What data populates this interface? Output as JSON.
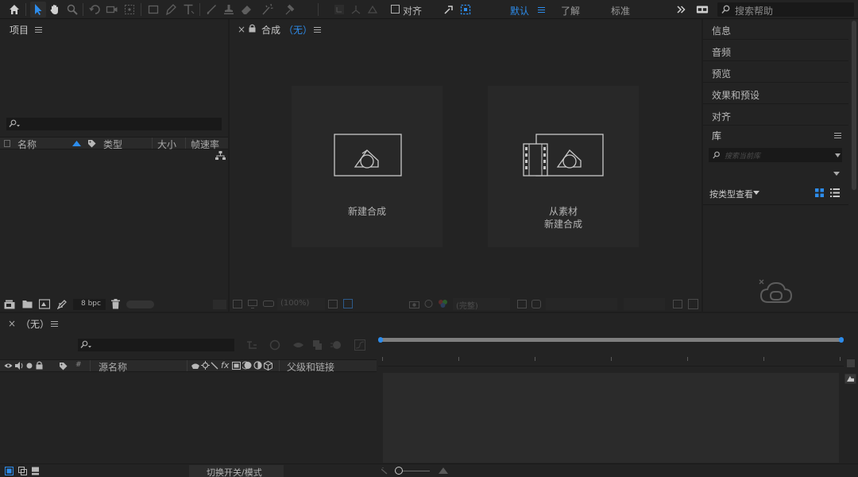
{
  "toolbar": {
    "align_label": "对齐",
    "workspaces": [
      "默认",
      "了解",
      "标准"
    ],
    "active_workspace": "默认",
    "search_placeholder": "搜索帮助",
    "accent": "#2d8ceb"
  },
  "project_panel": {
    "title": "项目",
    "columns": [
      "名称",
      "类型",
      "大小",
      "帧速率"
    ],
    "bit_depth": "8 bpc"
  },
  "comp_panel": {
    "tab_label": "合成",
    "tab_value": "（无）",
    "new_comp_label": "新建合成",
    "from_footage_line1": "从素材",
    "from_footage_line2": "新建合成",
    "zoom": "(100%)",
    "resolution": "(完整)"
  },
  "right_panel": {
    "items": [
      "信息",
      "音频",
      "预览",
      "效果和预设",
      "对齐"
    ],
    "library_title": "库",
    "library_search_placeholder": "搜索当前库",
    "view_by_type": "按类型查看"
  },
  "timeline": {
    "tab_label": "（无）",
    "columns": [
      "源名称",
      "父级和链接"
    ],
    "toggle_label": "切换开关/模式"
  }
}
